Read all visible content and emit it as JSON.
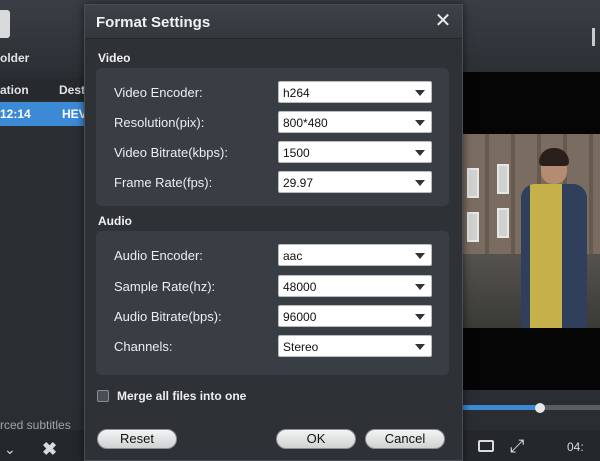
{
  "background": {
    "toolbar": {
      "folder_label": "older"
    },
    "list": {
      "col1_header": "ation",
      "col2_header": "Dest",
      "row_time": "12:14",
      "row_dest": "HEV"
    },
    "subtitles_label": "rced subtitles",
    "player": {
      "time": "04:"
    }
  },
  "dialog": {
    "title": "Format Settings",
    "video": {
      "section_title": "Video",
      "fields": [
        {
          "label": "Video Encoder:",
          "value": "h264"
        },
        {
          "label": "Resolution(pix):",
          "value": "800*480"
        },
        {
          "label": "Video Bitrate(kbps):",
          "value": "1500"
        },
        {
          "label": "Frame Rate(fps):",
          "value": "29.97"
        }
      ]
    },
    "audio": {
      "section_title": "Audio",
      "fields": [
        {
          "label": "Audio Encoder:",
          "value": "aac"
        },
        {
          "label": "Sample Rate(hz):",
          "value": "48000"
        },
        {
          "label": "Audio Bitrate(bps):",
          "value": "96000"
        },
        {
          "label": "Channels:",
          "value": "Stereo"
        }
      ]
    },
    "merge_label": "Merge all files into one",
    "merge_checked": false,
    "buttons": {
      "reset": "Reset",
      "ok": "OK",
      "cancel": "Cancel"
    }
  },
  "progress": {
    "fraction": 0.55
  },
  "colors": {
    "accent": "#3c8ad6",
    "dialog_bg": "#2e3237",
    "section_bg": "#393e44"
  }
}
